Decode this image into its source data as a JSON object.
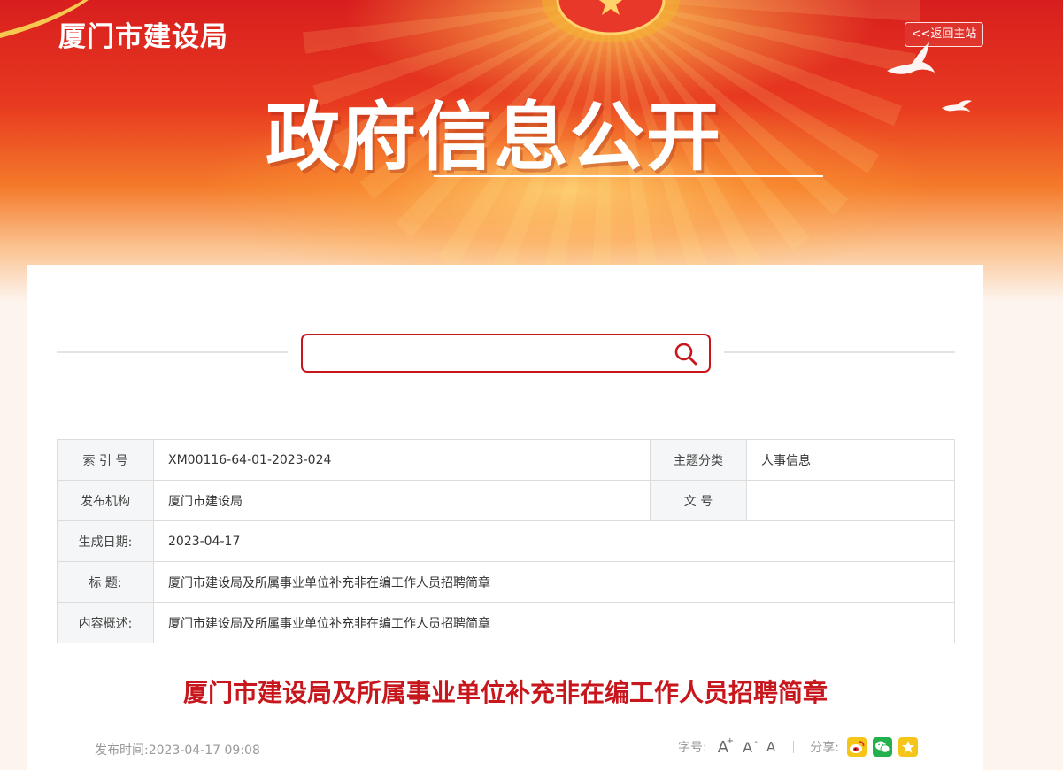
{
  "header": {
    "site_title": "厦门市建设局",
    "back_label": "<<返回主站",
    "hero_title": "政府信息公开"
  },
  "search": {
    "placeholder": "",
    "value": ""
  },
  "info_table": {
    "index_label": "索 引 号",
    "index_value": "XM00116-64-01-2023-024",
    "topic_label": "主题分类",
    "topic_value": "人事信息",
    "org_label": "发布机构",
    "org_value": "厦门市建设局",
    "docno_label": "文 号",
    "docno_value": "",
    "date_label": "生成日期:",
    "date_value": "2023-04-17",
    "title_label": "标 题:",
    "title_value": "厦门市建设局及所属事业单位补充非在编工作人员招聘简章",
    "summary_label": "内容概述:",
    "summary_value": "厦门市建设局及所属事业单位补充非在编工作人员招聘简章"
  },
  "article": {
    "title": "厦门市建设局及所属事业单位补充非在编工作人员招聘简章",
    "publish_time": "发布时间:2023-04-17 09:08",
    "font_size_label": "字号:",
    "font_large": "A",
    "font_medium": "A",
    "font_small": "A",
    "share_label": "分享:"
  },
  "icons": {
    "search": "search-icon",
    "weibo": "weibo-icon",
    "wechat": "wechat-icon",
    "qzone": "qzone-icon"
  },
  "colors": {
    "accent_red": "#c8161d",
    "banner_red": "#d81e1e",
    "weibo_yellow": "#f5c518",
    "wechat_green": "#22b14c"
  }
}
